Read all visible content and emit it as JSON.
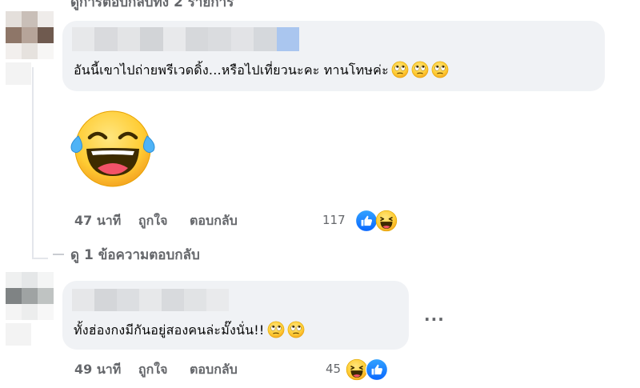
{
  "top_truncated": "ดูการตอบกลับทั้ง 2 รายการ",
  "comment1": {
    "text": "อันนี้เขาไปถ่ายพรีเวดดิ้ง...หรือไปเที่ยวนะคะ ทานโทษค่ะ",
    "emojis": [
      "rolling-eyes-emoji",
      "rolling-eyes-emoji",
      "rolling-eyes-emoji"
    ]
  },
  "sticker": "laughing-tears-emoji",
  "comment1_meta": {
    "time": "47 นาที",
    "like": "ถูกใจ",
    "reply": "ตอบกลับ",
    "reaction_count": "117",
    "reactions": [
      "like-icon",
      "haha-icon"
    ]
  },
  "view_replies": "ดู 1 ข้อความตอบกลับ",
  "comment2": {
    "text": "ทั้งฮ่องกงมีกันอยู่สองคนล่ะมั๊งนั่น!!",
    "emojis": [
      "rolling-eyes-emoji",
      "rolling-eyes-emoji"
    ],
    "more": "..."
  },
  "comment2_meta": {
    "time": "49 นาที",
    "like": "ถูกใจ",
    "reply": "ตอบกลับ",
    "reaction_count": "45",
    "reactions": [
      "haha-icon",
      "like-icon"
    ]
  },
  "colors": {
    "bubble": "#f0f2f5",
    "meta_text": "#65676b",
    "like_blue": "#1877f2",
    "emoji_yellow": "#ffcc33"
  }
}
